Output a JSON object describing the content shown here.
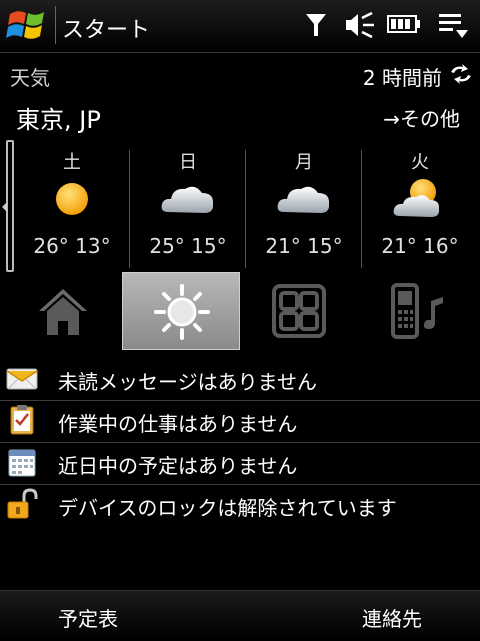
{
  "status_bar": {
    "title": "スタート",
    "icons": [
      "windows-logo-icon",
      "signal-icon",
      "speaker-icon",
      "battery-icon",
      "menu-icon"
    ]
  },
  "weather": {
    "label": "天気",
    "updated": "2 時間前",
    "location": "東京, JP",
    "more_link": "→その他",
    "forecast": [
      {
        "day": "土",
        "temps": "26° 13°",
        "condition": "sunny-icon"
      },
      {
        "day": "日",
        "temps": "25° 15°",
        "condition": "cloudy-icon"
      },
      {
        "day": "月",
        "temps": "21° 15°",
        "condition": "cloudy-icon"
      },
      {
        "day": "火",
        "temps": "21° 16°",
        "condition": "partly-cloudy-icon"
      }
    ]
  },
  "tabs": [
    {
      "name": "home",
      "icon": "home-icon",
      "active": false
    },
    {
      "name": "weather",
      "icon": "sun-icon",
      "active": true
    },
    {
      "name": "apps",
      "icon": "grid-icon",
      "active": false
    },
    {
      "name": "music",
      "icon": "phone-music-icon",
      "active": false
    }
  ],
  "notifications": [
    {
      "icon": "envelope-icon",
      "text": "未読メッセージはありません"
    },
    {
      "icon": "clipboard-icon",
      "text": "作業中の仕事はありません"
    },
    {
      "icon": "calendar-icon",
      "text": "近日中の予定はありません"
    },
    {
      "icon": "unlock-icon",
      "text": "デバイスのロックは解除されています"
    }
  ],
  "softkeys": {
    "left": "予定表",
    "right": "連絡先"
  },
  "colors": {
    "background": "#000000",
    "active_tab": "#a0a0a0",
    "separator": "#3d3d3d"
  }
}
